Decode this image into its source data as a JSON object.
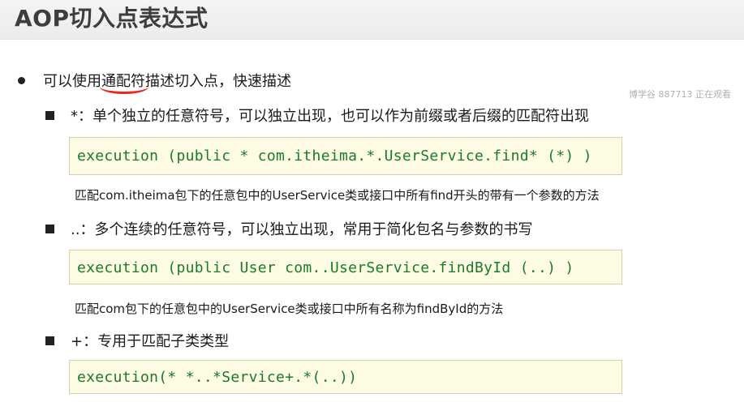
{
  "slide": {
    "title": "AOP切入点表达式",
    "watermark": "博学谷 887713 正在观看",
    "main_bullet": {
      "before": "可以使用",
      "highlight": "通配符",
      "after": "描述切入点，快速描述"
    },
    "items": [
      {
        "label": "*：单个独立的任意符号，可以独立出现，也可以作为前缀或者后缀的匹配符出现",
        "code": "execution (public * com.itheima.*.UserService.find* (*) )",
        "description": "匹配com.itheima包下的任意包中的UserService类或接口中所有find开头的带有一个参数的方法"
      },
      {
        "label": "..：多个连续的任意符号，可以独立出现，常用于简化包名与参数的书写",
        "code": "execution (public User com..UserService.findById (..) )",
        "description": "匹配com包下的任意包中的UserService类或接口中所有名称为findById的方法"
      },
      {
        "label": "+：专用于匹配子类类型",
        "code": "execution(* *..*Service+.*(..))",
        "description": ""
      }
    ]
  },
  "colors": {
    "code_text": "#1a7a2a",
    "code_background": "#fdfbe4",
    "underline": "#e8261c",
    "title": "#3d3d3d"
  }
}
